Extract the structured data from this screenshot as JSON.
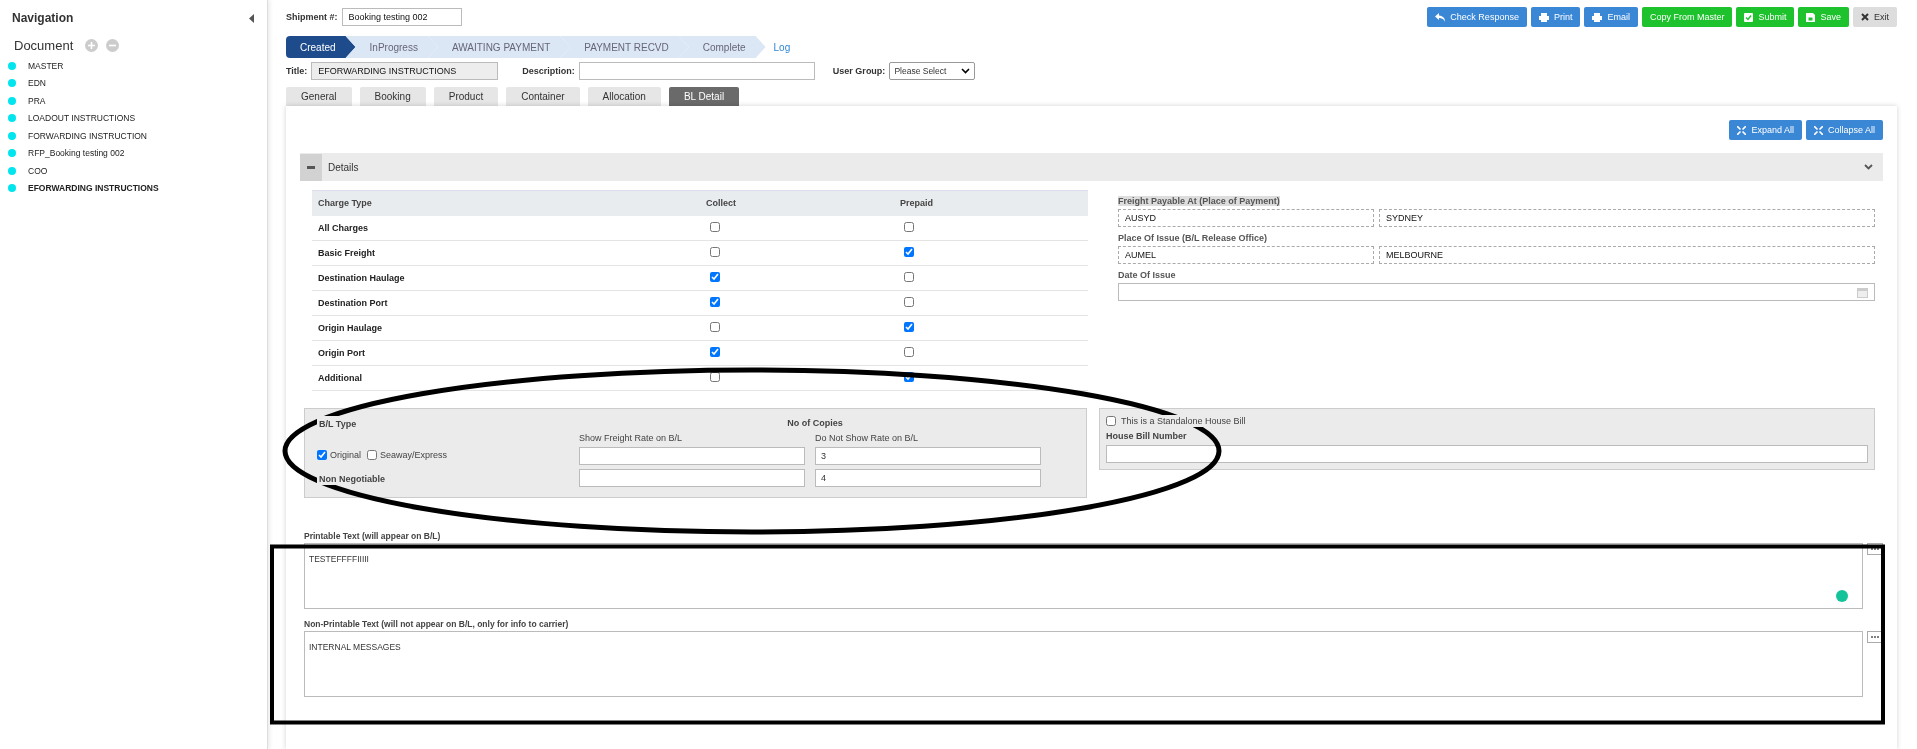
{
  "sidebar": {
    "title": "Navigation",
    "section": "Document",
    "items": [
      {
        "label": "MASTER",
        "selected": false
      },
      {
        "label": "EDN",
        "selected": false
      },
      {
        "label": "PRA",
        "selected": false
      },
      {
        "label": "LOADOUT INSTRUCTIONS",
        "selected": false
      },
      {
        "label": "FORWARDING INSTRUCTION",
        "selected": false
      },
      {
        "label": "RFP_Booking testing 002",
        "selected": false
      },
      {
        "label": "COO",
        "selected": false
      },
      {
        "label": "EFORWARDING INSTRUCTIONS",
        "selected": true
      }
    ]
  },
  "header": {
    "shipment_label": "Shipment #:",
    "shipment_value": "Booking testing 002",
    "buttons": [
      {
        "label": "Check Response",
        "kind": "blue"
      },
      {
        "label": "Print",
        "kind": "blue"
      },
      {
        "label": "Email",
        "kind": "blue"
      },
      {
        "label": "Copy From Master",
        "kind": "green"
      },
      {
        "label": "Submit",
        "kind": "green"
      },
      {
        "label": "Save",
        "kind": "green"
      },
      {
        "label": "Exit",
        "kind": "grey"
      }
    ]
  },
  "stepper": {
    "steps": [
      {
        "label": "Created",
        "selected": true
      },
      {
        "label": "InProgress",
        "selected": false
      },
      {
        "label": "AWAITING PAYMENT",
        "selected": false
      },
      {
        "label": "PAYMENT RECVD",
        "selected": false
      },
      {
        "label": "Complete",
        "selected": false
      }
    ],
    "link": "Log"
  },
  "form": {
    "title_label": "Title:",
    "title_value": "EFORWARDING INSTRUCTIONS",
    "description_label": "Description:",
    "user_group_label": "User Group:",
    "user_group_value": "Please Select"
  },
  "tabs": [
    {
      "label": "General",
      "selected": false
    },
    {
      "label": "Booking",
      "selected": false
    },
    {
      "label": "Product",
      "selected": false
    },
    {
      "label": "Container",
      "selected": false
    },
    {
      "label": "Allocation",
      "selected": false
    },
    {
      "label": "BL Detail",
      "selected": true
    }
  ],
  "panel_buttons": [
    "Expand All",
    "Collapse All"
  ],
  "section": {
    "title": "Details",
    "expanded": true
  },
  "charges": {
    "columns": [
      "Charge Type",
      "Collect",
      "Prepaid"
    ],
    "rows": [
      {
        "label": "All Charges",
        "collect": false,
        "prepaid": false
      },
      {
        "label": "Basic Freight",
        "collect": false,
        "prepaid": true
      },
      {
        "label": "Destination Haulage",
        "collect": true,
        "prepaid": false
      },
      {
        "label": "Destination Port",
        "collect": true,
        "prepaid": false
      },
      {
        "label": "Origin Haulage",
        "collect": false,
        "prepaid": true
      },
      {
        "label": "Origin Port",
        "collect": true,
        "prepaid": false
      },
      {
        "label": "Additional",
        "collect": false,
        "prepaid": true
      }
    ]
  },
  "places": [
    {
      "label": "Freight Payable At (Place of Payment)",
      "code": "AUSYD",
      "name": "SYDNEY"
    },
    {
      "label": "Place Of Issue (B/L Release Office)",
      "code": "AUMEL",
      "name": "MELBOURNE"
    }
  ],
  "date_of_issue": {
    "label": "Date Of Issue"
  },
  "bl_type": {
    "label": "B/L Type",
    "copies_label": "No of Copies",
    "options": [
      {
        "label": "Original",
        "checked": true
      },
      {
        "label": "Seaway/Express",
        "checked": false
      }
    ],
    "non_negotiable": "Non Negotiable",
    "columns": [
      "Show Freight Rate on B/L",
      "Do Not Show Rate on B/L"
    ],
    "rows": [
      {
        "do_not_show": "3"
      },
      {
        "do_not_show": "4"
      }
    ]
  },
  "house_bill": {
    "checkbox_label": "This is a Standalone House Bill",
    "checked": false,
    "label": "House Bill Number"
  },
  "texts": [
    {
      "label": "Printable Text (will appear on B/L)",
      "value": "TESTEFFFFIIIII",
      "grammar_badge": true
    },
    {
      "label": "Non-Printable Text (will not appear on B/L, only for info to carrier)",
      "value": "INTERNAL MESSAGES",
      "grammar_badge": false
    }
  ],
  "annotations": [
    {
      "kind": "ellipse"
    },
    {
      "kind": "rectangle"
    }
  ]
}
